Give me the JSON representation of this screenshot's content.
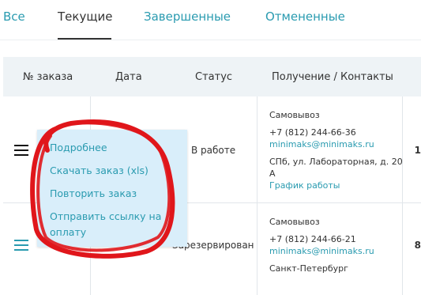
{
  "tabs": [
    {
      "label": "Все",
      "active": false
    },
    {
      "label": "Текущие",
      "active": true
    },
    {
      "label": "Завершенные",
      "active": false
    },
    {
      "label": "Отмененные",
      "active": false
    }
  ],
  "table": {
    "headers": [
      "№ заказа",
      "Дата",
      "Статус",
      "Получение / Контакты"
    ],
    "rows": [
      {
        "status": "В работе",
        "delivery": "Самовывоз",
        "phone": "+7 (812) 244-66-36",
        "email": "minimaks@minimaks.ru",
        "address_line1": "СПб, ул. Лабораторная, д. 20",
        "address_line2": "А",
        "hours_link": "График работы",
        "edge_value": "1"
      },
      {
        "status": "Зарезервирован",
        "delivery": "Самовывоз",
        "phone": "+7 (812) 244-66-21",
        "email": "minimaks@minimaks.ru",
        "address_line1": "Санкт-Петербург",
        "edge_value": "8"
      }
    ]
  },
  "context_menu": {
    "items": [
      "Подробнее",
      "Скачать заказ (xls)",
      "Повторить заказ",
      "Отправить ссылку на",
      "оплату"
    ]
  },
  "colors": {
    "accent": "#2a9bb0",
    "annotation": "#e0161b",
    "menu_bg": "#d9eefa",
    "header_bg": "#eef3f6"
  },
  "icons": {
    "row_menu": "hamburger-icon"
  }
}
